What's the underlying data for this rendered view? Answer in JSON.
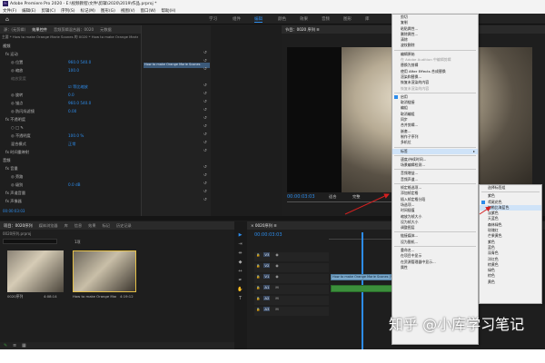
{
  "window": {
    "title": "Adobe Premiere Pro 2020 - E:\\视频教程\\文件\\剪辑\\2020\\2019\\作品.prproj *"
  },
  "menu": [
    "文件(F)",
    "编辑(E)",
    "剪辑(C)",
    "序列(S)",
    "标记(M)",
    "图形(G)",
    "视图(V)",
    "窗口(W)",
    "帮助(H)"
  ],
  "workspace_tabs": [
    "学习",
    "组件",
    "编辑",
    "颜色",
    "效果",
    "音频",
    "图形",
    "库"
  ],
  "workspace_active": "编辑",
  "effect_controls": {
    "tabs": [
      "源：(无剪辑)",
      "效果控件",
      "音频剪辑混合器：0020",
      "元数据"
    ],
    "breadcrumb": "主要 * How to make Orange Marie Scones 的 0020 * How to make Orange Marie Scones",
    "clip_label": "How to make Orange Marie Scones",
    "rows": [
      {
        "label": "视频",
        "value": "",
        "kind": "section"
      },
      {
        "label": "fx 运动",
        "value": "",
        "kind": "header"
      },
      {
        "label": "◎ 位置",
        "value": "960.0   540.0",
        "kind": "prop"
      },
      {
        "label": "◎ 缩放",
        "value": "100.0",
        "kind": "prop"
      },
      {
        "label": "缩放宽度",
        "value": "",
        "kind": "prop-dim"
      },
      {
        "label": "",
        "value": "☑ 等比缩放",
        "kind": "prop"
      },
      {
        "label": "◎ 旋转",
        "value": "0.0",
        "kind": "prop"
      },
      {
        "label": "◎ 锚点",
        "value": "960.0   540.0",
        "kind": "prop"
      },
      {
        "label": "◎ 防闪烁滤镜",
        "value": "0.00",
        "kind": "prop"
      },
      {
        "label": "fx 不透明度",
        "value": "",
        "kind": "header"
      },
      {
        "label": "○ □ ✎",
        "value": "",
        "kind": "prop"
      },
      {
        "label": "◎ 不透明度",
        "value": "100.0 %",
        "kind": "prop"
      },
      {
        "label": "混合模式",
        "value": "正常",
        "kind": "prop"
      },
      {
        "label": "fx 时间重映射",
        "value": "",
        "kind": "header"
      },
      {
        "label": "音频",
        "value": "",
        "kind": "section"
      },
      {
        "label": "fx 音量",
        "value": "",
        "kind": "header"
      },
      {
        "label": "◎ 旁路",
        "value": "",
        "kind": "prop"
      },
      {
        "label": "◎ 级别",
        "value": "0.0 dB",
        "kind": "prop"
      },
      {
        "label": "fx 声道音量",
        "value": "",
        "kind": "header"
      },
      {
        "label": "fx 声像器",
        "value": "",
        "kind": "header"
      }
    ],
    "footer_timecode": "00:00:03:03"
  },
  "program_monitor": {
    "title": "节目：0020 序列 ≡",
    "timecode": "00:00:03:03",
    "fit": "适合",
    "quality": "完整"
  },
  "project_panel": {
    "tabs": [
      "项目：0020序列",
      "媒体浏览器",
      "库",
      "信息",
      "效果",
      "标记",
      "历史记录"
    ],
    "path": "0020序列.prproj",
    "count": "1项",
    "items": [
      {
        "name": "0020序列",
        "duration": "4:08:14"
      },
      {
        "name": "How to make Orange Mar...",
        "duration": "4:19:12"
      }
    ]
  },
  "timeline": {
    "title": "× 0020序列 ≡",
    "timecode": "00:00:03:03",
    "tracks": [
      "V3",
      "V2",
      "V1",
      "A1",
      "A2",
      "A3"
    ],
    "clip_name": "How to make Orange Marie Scones [V]"
  },
  "context_menu": {
    "items": [
      {
        "label": "剪切",
        "state": "normal"
      },
      {
        "label": "复制",
        "state": "normal"
      },
      {
        "label": "粘贴属性...",
        "state": "normal"
      },
      {
        "label": "删除属性...",
        "state": "normal"
      },
      {
        "label": "清除",
        "state": "normal"
      },
      {
        "label": "波纹删除",
        "state": "normal"
      },
      {
        "sep": true
      },
      {
        "label": "编辑原始",
        "state": "normal"
      },
      {
        "label": "在 Adobe Audition 中编辑剪辑",
        "state": "disabled"
      },
      {
        "label": "替换为剪辑",
        "state": "normal"
      },
      {
        "label": "使用 After Effects 合成替换",
        "state": "normal"
      },
      {
        "label": "渲染和替换...",
        "state": "normal"
      },
      {
        "label": "恢复未渲染的内容",
        "state": "normal"
      },
      {
        "label": "恢复未渲染的内容",
        "state": "disabled"
      },
      {
        "sep": true
      },
      {
        "label": "启用",
        "state": "checked"
      },
      {
        "label": "取消链接",
        "state": "normal"
      },
      {
        "label": "编组",
        "state": "normal"
      },
      {
        "label": "取消编组",
        "state": "normal"
      },
      {
        "label": "同步",
        "state": "normal"
      },
      {
        "label": "合并剪辑...",
        "state": "normal"
      },
      {
        "label": "嵌套...",
        "state": "normal"
      },
      {
        "label": "制作子序列",
        "state": "normal"
      },
      {
        "label": "多机位",
        "state": "normal"
      },
      {
        "sep": true
      },
      {
        "label": "标签",
        "state": "highlight",
        "submenu": true
      },
      {
        "sep": true
      },
      {
        "label": "速度/持续时间...",
        "state": "normal"
      },
      {
        "label": "场景编辑检测...",
        "state": "normal"
      },
      {
        "sep": true
      },
      {
        "label": "音频增益...",
        "state": "normal"
      },
      {
        "label": "音频声道...",
        "state": "normal"
      },
      {
        "sep": true
      },
      {
        "label": "帧定格选项...",
        "state": "normal"
      },
      {
        "label": "添加帧定格",
        "state": "normal"
      },
      {
        "label": "插入帧定格分段",
        "state": "normal"
      },
      {
        "label": "场选项...",
        "state": "normal"
      },
      {
        "label": "时间插值",
        "state": "normal"
      },
      {
        "label": "缩放为帧大小",
        "state": "normal"
      },
      {
        "label": "设为帧大小",
        "state": "normal"
      },
      {
        "label": "调整图层",
        "state": "normal"
      },
      {
        "sep": true
      },
      {
        "label": "链接媒体...",
        "state": "normal"
      },
      {
        "label": "设为脱机...",
        "state": "normal"
      },
      {
        "sep": true
      },
      {
        "label": "重命名...",
        "state": "normal"
      },
      {
        "label": "在项目中显示",
        "state": "normal"
      },
      {
        "label": "在资源管理器中显示...",
        "state": "normal"
      },
      {
        "label": "属性",
        "state": "normal"
      }
    ]
  },
  "label_submenu": {
    "items": [
      {
        "label": "选择标签组",
        "state": "normal"
      },
      {
        "sep": true
      },
      {
        "label": "紫色",
        "state": "normal"
      },
      {
        "label": "鸢尾花色",
        "state": "checked"
      },
      {
        "label": "加勒比海蓝色",
        "state": "highlight"
      },
      {
        "label": "淡紫色",
        "state": "normal"
      },
      {
        "label": "天蓝色",
        "state": "normal"
      },
      {
        "label": "森林绿色",
        "state": "normal"
      },
      {
        "label": "玫瑰红",
        "state": "normal"
      },
      {
        "label": "芒果黄色",
        "state": "normal"
      },
      {
        "label": "紫色",
        "state": "normal"
      },
      {
        "label": "蓝色",
        "state": "normal"
      },
      {
        "label": "深青色",
        "state": "normal"
      },
      {
        "label": "洋红色",
        "state": "normal"
      },
      {
        "label": "棕黄色",
        "state": "normal"
      },
      {
        "label": "绿色",
        "state": "normal"
      },
      {
        "label": "棕色",
        "state": "normal"
      },
      {
        "label": "黄色",
        "state": "normal"
      }
    ]
  },
  "watermark": "知乎 @小库学习笔记",
  "colors": {
    "accent": "#2d8ceb",
    "arrow": "#d42020",
    "menu_bg": "#f0f0f0",
    "highlight": "#cfe3f8"
  }
}
